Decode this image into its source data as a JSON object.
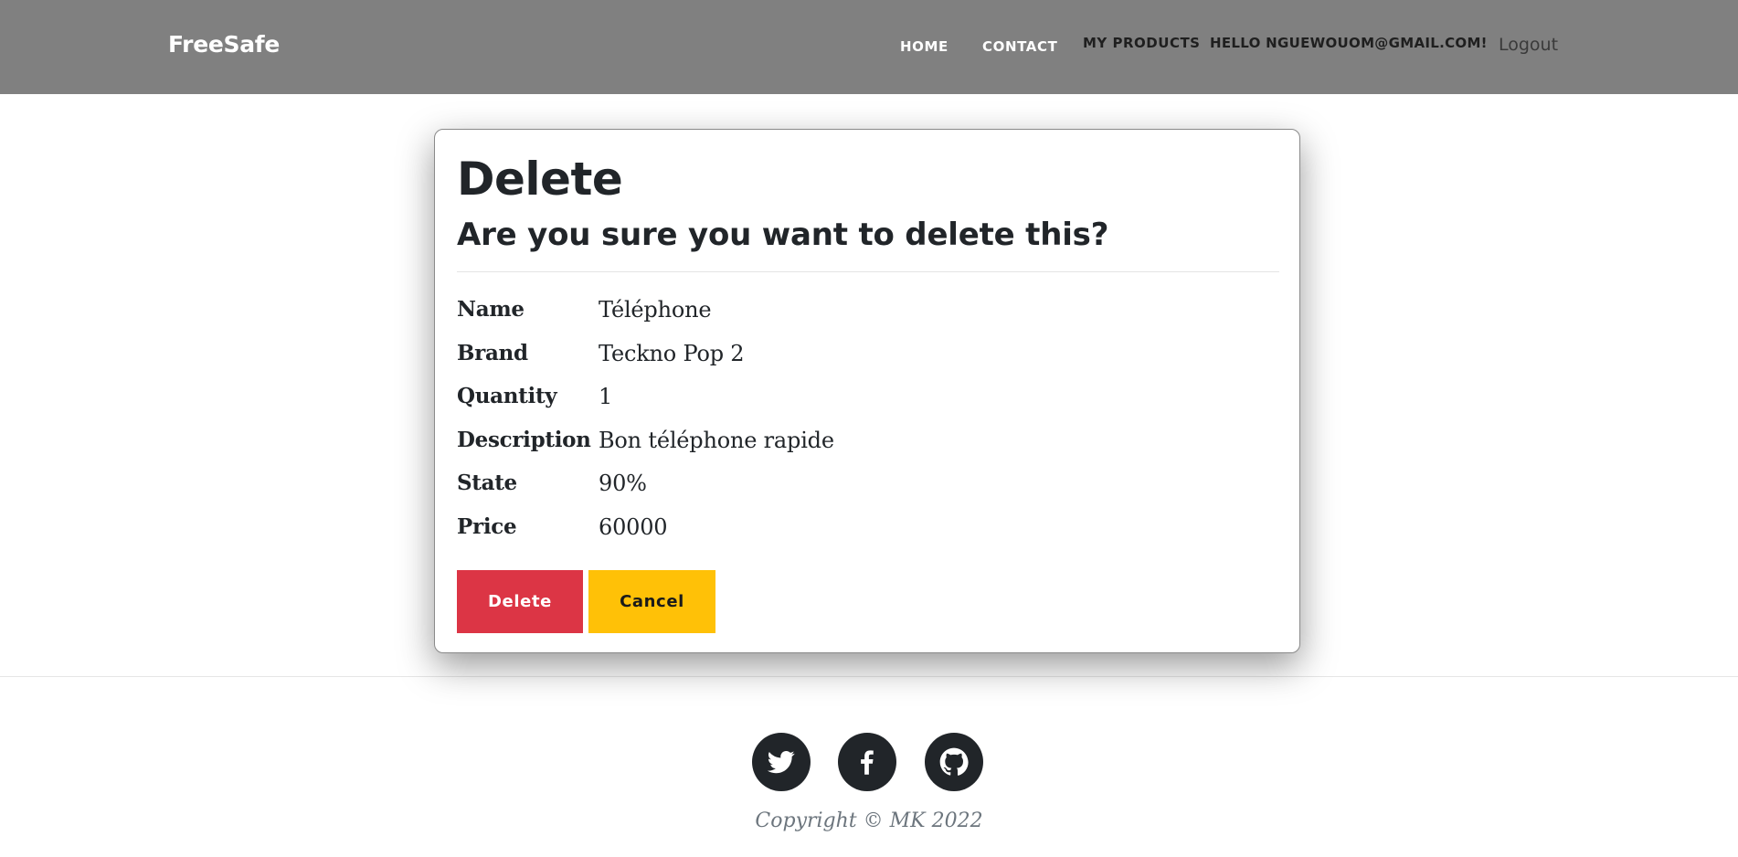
{
  "navbar": {
    "brand": "FreeSafe",
    "links": {
      "home": "HOME",
      "contact": "CONTACT",
      "my_products": "MY PRODUCTS",
      "hello": "HELLO NGUEWOUOM@GMAIL.COM!"
    },
    "logout": "Logout",
    "background_color": "#808080"
  },
  "card": {
    "title": "Delete",
    "subtitle": "Are you sure you want to delete this?",
    "details": [
      {
        "label": "Name",
        "value": "Téléphone"
      },
      {
        "label": "Brand",
        "value": "Teckno Pop 2"
      },
      {
        "label": "Quantity",
        "value": "1"
      },
      {
        "label": "Description",
        "value": "Bon téléphone rapide"
      },
      {
        "label": "State",
        "value": "90%"
      },
      {
        "label": "Price",
        "value": "60000"
      }
    ],
    "buttons": {
      "delete": "Delete",
      "cancel": "Cancel"
    }
  },
  "colors": {
    "danger": "#dc3545",
    "warning": "#ffc107",
    "dark": "#212529"
  },
  "footer": {
    "social": [
      {
        "icon": "twitter-icon"
      },
      {
        "icon": "facebook-icon"
      },
      {
        "icon": "github-icon"
      }
    ],
    "copyright": "Copyright © MK 2022"
  }
}
